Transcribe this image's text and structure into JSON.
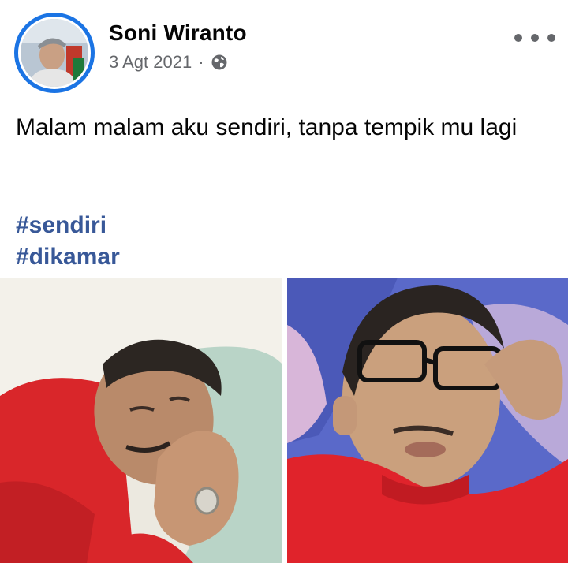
{
  "post": {
    "author": "Soni Wiranto",
    "date": "3 Agt 2021",
    "separator": "·",
    "privacy_icon": "globe-icon",
    "more_icon": "more-options-icon",
    "text": "Malam malam aku sendiri, tanpa tempik mu lagi",
    "hashtags": [
      "#sendiri",
      "#dikamar"
    ],
    "photos": [
      "photo-man-on-pillow",
      "photo-man-with-glasses"
    ]
  },
  "colors": {
    "accent": "#1b74e4",
    "hashtag": "#385898",
    "meta_text": "#65676b"
  }
}
